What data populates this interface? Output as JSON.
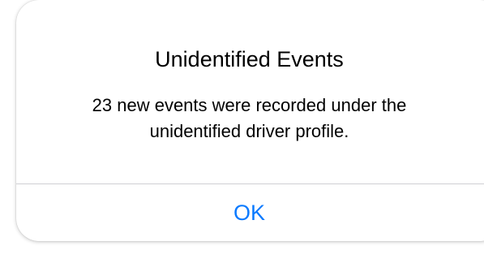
{
  "alert": {
    "title": "Unidentified Events",
    "message_line1": "23 new events were recorded under the",
    "message_line2": "unidentified driver profile.",
    "ok_label": "OK"
  },
  "colors": {
    "button_text": "#0a7aff",
    "divider": "#cfcfd3",
    "background": "#ffffff"
  }
}
